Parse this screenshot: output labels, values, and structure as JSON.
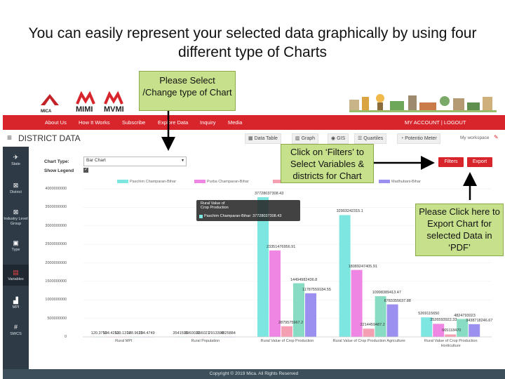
{
  "slide": {
    "title": "You can easily represent your selected data graphically by using four different type of Charts"
  },
  "callouts": {
    "chart_type": "Please Select /Change  type of Chart",
    "filters": "Click on ‘Filters’ to Select Variables & districts for Chart",
    "export": "Please Click here to Export Chart for selected Data in ‘PDF’"
  },
  "logos": {
    "mica": "MICA",
    "mimi": "MIMI",
    "mvmi": "MVMI"
  },
  "nav": {
    "items": [
      "About Us",
      "How It Works",
      "Subscribe",
      "Explore Data",
      "Inquiry",
      "Media"
    ],
    "account": "MY ACCOUNT | LOGOUT"
  },
  "page": {
    "title": "DISTRICT DATA",
    "tabs": [
      "Data Table",
      "Graph",
      "GIS",
      "Quartiles",
      "Potentio Meter"
    ],
    "workspace": "My workspace"
  },
  "sidebar": {
    "items": [
      {
        "label": "State",
        "icon": "map-icon"
      },
      {
        "label": "District",
        "icon": "district-icon"
      },
      {
        "label": "Industry Level Group",
        "icon": "industry-icon"
      },
      {
        "label": "Type",
        "icon": "type-icon"
      },
      {
        "label": "Variables",
        "icon": "variables-icon"
      },
      {
        "label": "MPI",
        "icon": "mpi-icon"
      },
      {
        "label": "SWCS",
        "icon": "swcs-icon"
      }
    ]
  },
  "controls": {
    "chart_type_label": "Chart Type:",
    "chart_type_value": "Bar Chart",
    "show_legend_label": "Show Legend",
    "filters_label": "Filters",
    "export_label": "Export"
  },
  "tooltip": {
    "header": "37728037308.43",
    "title": "Rural Value of Crop Production",
    "line": "Paschim Champaran-Bihar: 37728037308.43"
  },
  "footer": "Copyright © 2019 Mica. All Rights Reserved",
  "chart_data": {
    "type": "bar",
    "categories": [
      "Rural MPI",
      "Rural Population",
      "Rural Value of Crop Production",
      "Rural Value of Crop Production Agriculture",
      "Rural Value of Crop Production Horticulture"
    ],
    "y_ticks": [
      "4000000000",
      "3500000000",
      "3000000000",
      "2500000000",
      "2000000000",
      "1500000000",
      "1000000000",
      "500000000",
      "0"
    ],
    "ylim": [
      0,
      40000000000
    ],
    "y_scale_note": "",
    "series": [
      {
        "name": "Paschim Champaran-Bihar",
        "color": "#7ee6e0",
        "values": [
          120.3755,
          3541599,
          37728037308.43,
          32903242315.1,
          5269115650
        ]
      },
      {
        "name": "Purba Champaran-Bihar",
        "color": "#ef86e3",
        "values": [
          124.4253,
          3960020,
          23351476956.91,
          18089247405.91,
          3526593922.33
        ]
      },
      {
        "name": "Sheohar-Bihar",
        "color": "#f59fb2",
        "values": [
          119.1374,
          656021,
          2879575967.2,
          2214459487.2,
          665118470
        ]
      },
      {
        "name": "Sitamarhi-Bihar",
        "color": "#87dcc3",
        "values": [
          128.9625,
          2913303,
          14494982436.8,
          10998389413.47,
          4824793023
        ]
      },
      {
        "name": "Madhubani-Bihar",
        "color": "#9b8ff0",
        "values": [
          124.4749,
          4825884,
          11787559184.55,
          8783355637.88,
          3438718246.67
        ]
      }
    ],
    "data_labels": [
      [
        "120.3755",
        "124.4253",
        "119.1374",
        "128.9625",
        "124.4749"
      ],
      [
        "3541599",
        "3960020",
        "656021",
        "2913303",
        "4825884"
      ],
      [
        "37728037308.43",
        "23351476956.91",
        "2879575967.2",
        "14494982436.8",
        "11787559184.55"
      ],
      [
        "32903242315.1",
        "18089247405.91",
        "2214459487.2",
        "10998389413.47",
        "8783355637.88"
      ],
      [
        "5269115650",
        "3526593922.33",
        "665118470",
        "4824793023",
        "3438718246.67"
      ]
    ],
    "legend_position": "top"
  }
}
